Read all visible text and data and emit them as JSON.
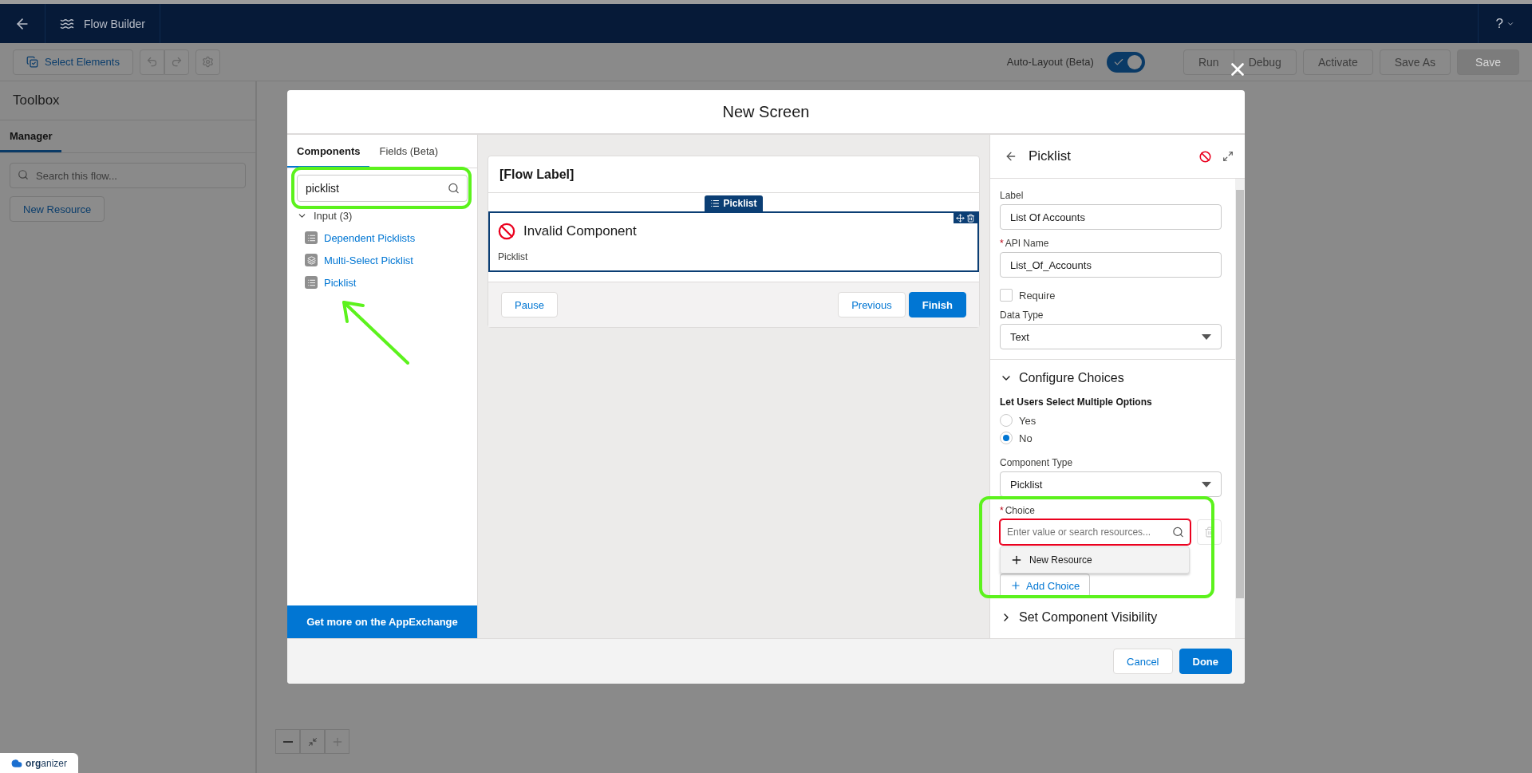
{
  "app_bar": {
    "title": "Flow Builder",
    "help": "?"
  },
  "toolbar": {
    "select_elements": "Select Elements",
    "auto_layout": {
      "label": "Auto-Layout (Beta)",
      "on": true
    },
    "buttons": [
      {
        "label": "Run",
        "kind": "group",
        "disabled": true
      },
      {
        "label": "Debug",
        "kind": "group",
        "disabled": true
      },
      {
        "label": "Activate",
        "kind": "plain",
        "disabled": true
      },
      {
        "label": "Save As",
        "kind": "plain",
        "disabled": true
      },
      {
        "label": "Save",
        "kind": "primary",
        "disabled": true
      }
    ]
  },
  "toolbox": {
    "title": "Toolbox",
    "tabs": [
      {
        "label": "Manager",
        "selected": true
      }
    ],
    "search": {
      "placeholder": "Search this flow..."
    },
    "new_resource": "New Resource"
  },
  "modal": {
    "title": "New Screen",
    "components_panel": {
      "tabs": [
        {
          "label": "Components",
          "selected": true
        },
        {
          "label": "Fields (Beta)",
          "selected": false
        }
      ],
      "search": {
        "value": "picklist"
      },
      "group": {
        "label": "Input (3)",
        "expanded": true,
        "items": [
          {
            "label": "Dependent Picklists",
            "kind": "single"
          },
          {
            "label": "Multi-Select Picklist",
            "kind": "multi"
          },
          {
            "label": "Picklist",
            "kind": "single"
          }
        ]
      },
      "appexchange": "Get more on the AppExchange"
    },
    "canvas": {
      "flow_label": "[Flow Label]",
      "tag": "Picklist",
      "component": {
        "title": "Invalid Component",
        "subtitle": "Picklist",
        "invalid": true
      },
      "left_buttons": [
        "Pause"
      ],
      "right_buttons": [
        {
          "label": "Previous",
          "kind": "neutral"
        },
        {
          "label": "Finish",
          "kind": "brand"
        }
      ]
    },
    "properties": {
      "title": "Picklist",
      "invalid": true,
      "label": {
        "label": "Label",
        "value": "List Of Accounts"
      },
      "api_name": {
        "marker": "*",
        "label": "API Name",
        "value": "List_Of_Accounts"
      },
      "require": {
        "label": "Require",
        "checked": false
      },
      "data_type": {
        "label": "Data Type",
        "value": "Text"
      },
      "configure": {
        "title": "Configure Choices",
        "expanded": true
      },
      "multiple": {
        "label": "Let Users Select Multiple Options",
        "options": [
          {
            "label": "Yes",
            "selected": false
          },
          {
            "label": "No",
            "selected": true
          }
        ]
      },
      "component_type": {
        "label": "Component Type",
        "value": "Picklist"
      },
      "choice": {
        "marker": "*",
        "label": "Choice",
        "placeholder": "Enter value or search resources...",
        "error": true
      },
      "dropdown": {
        "item": "New Resource"
      },
      "add_choice": "Add Choice",
      "visibility": {
        "title": "Set Component Visibility",
        "expanded": false
      }
    },
    "footer": {
      "cancel": "Cancel",
      "done": "Done"
    }
  },
  "badge": "**org**anizer"
}
